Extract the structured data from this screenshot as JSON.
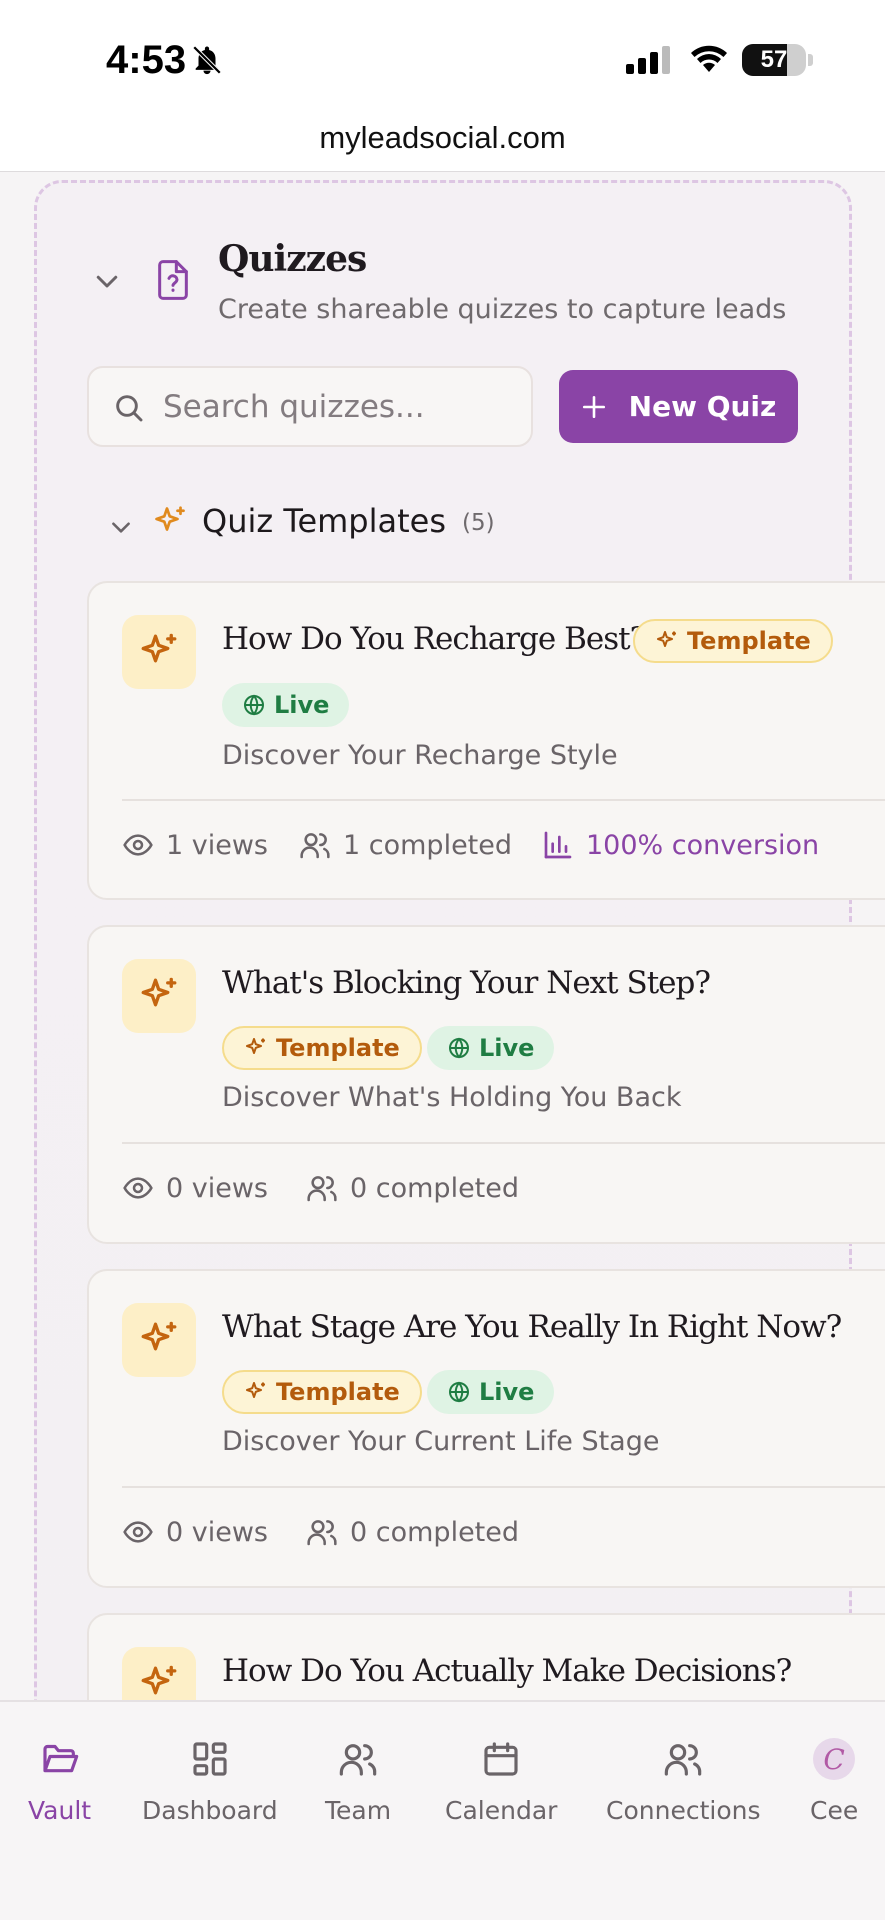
{
  "status_bar": {
    "time": "4:53",
    "battery": "57"
  },
  "browser": {
    "url": "myleadsocial.com"
  },
  "header": {
    "title": "Quizzes",
    "subtitle": "Create shareable quizzes to capture leads"
  },
  "search": {
    "placeholder": "Search quizzes..."
  },
  "new_quiz_button": {
    "label": "New Quiz"
  },
  "templates_section": {
    "title": "Quiz Templates",
    "count": "(5)"
  },
  "quizzes": [
    {
      "title": "How Do You Recharge Best?",
      "template_badge": "Template",
      "live_badge": "Live",
      "description": "Discover Your Recharge Style",
      "views": "1 views",
      "completed": "1 completed",
      "conversion": "100% conversion"
    },
    {
      "title": "What's Blocking Your Next Step?",
      "template_badge": "Template",
      "live_badge": "Live",
      "description": "Discover What's Holding You Back",
      "views": "0 views",
      "completed": "0 completed"
    },
    {
      "title": "What Stage Are You Really In Right Now?",
      "template_badge": "Template",
      "live_badge": "Live",
      "description": "Discover Your Current Life Stage",
      "views": "0 views",
      "completed": "0 completed"
    },
    {
      "title": "How Do You Actually Make Decisions?"
    }
  ],
  "bottom_nav": {
    "items": [
      {
        "label": "Vault",
        "icon": "folder-open-icon",
        "active": true
      },
      {
        "label": "Dashboard",
        "icon": "dashboard-grid-icon"
      },
      {
        "label": "Team",
        "icon": "team-users-icon"
      },
      {
        "label": "Calendar",
        "icon": "calendar-icon"
      },
      {
        "label": "Connections",
        "icon": "connections-users-icon"
      },
      {
        "label": "Cee",
        "icon": "avatar-icon",
        "avatar_letter": "C"
      }
    ]
  },
  "colors": {
    "accent": "#8a44a6",
    "template_badge": "#b35b0c",
    "live_badge": "#1f7d43",
    "sparkle": "#c96a14"
  }
}
